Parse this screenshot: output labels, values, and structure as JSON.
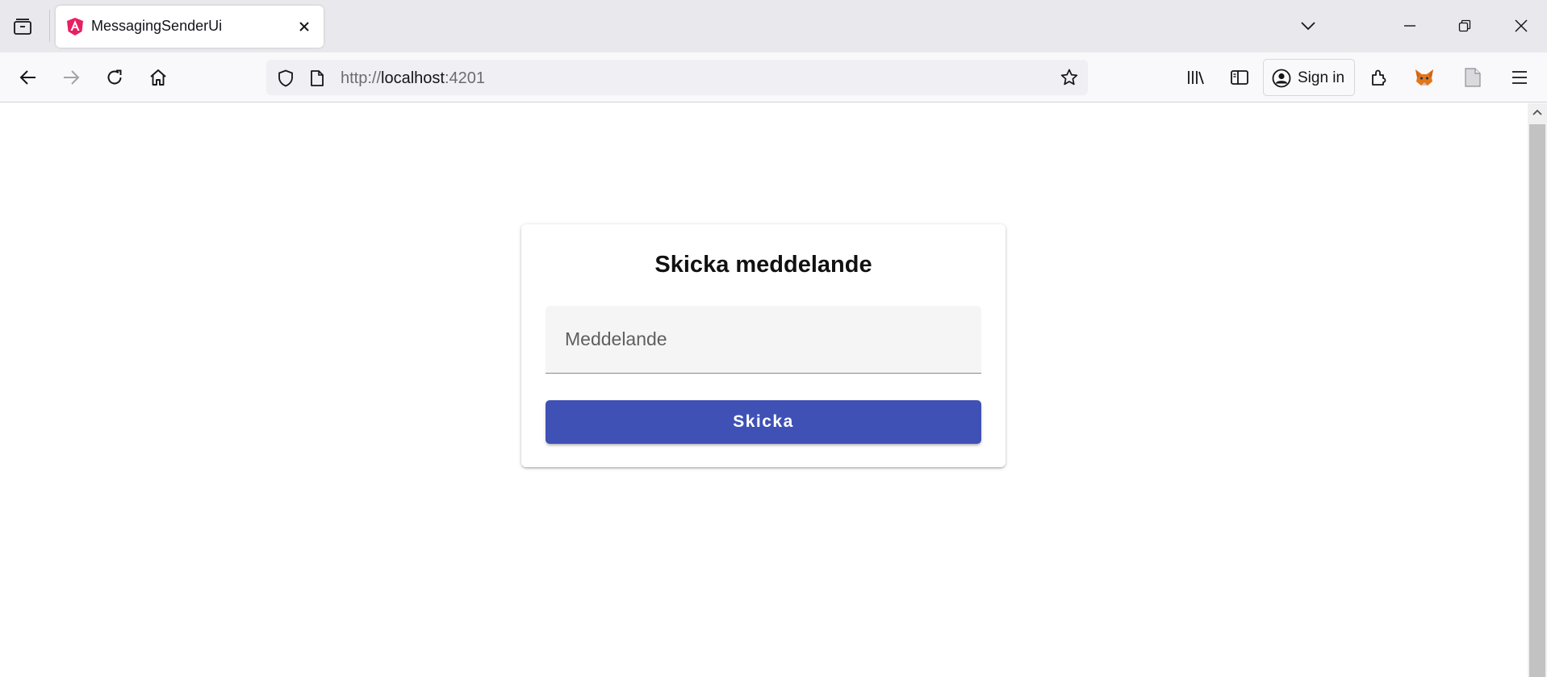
{
  "browser": {
    "tab": {
      "title": "MessagingSenderUi",
      "favicon": "angular-logo-icon"
    },
    "url": {
      "scheme": "http://",
      "host": "localhost",
      "port": ":4201"
    },
    "signin_label": "Sign in",
    "icons": {
      "list_all_tabs": "tab-list-icon",
      "tab_close": "close-icon",
      "tab_overflow": "chevron-down-icon",
      "minimize": "minimize-icon",
      "restore": "restore-icon",
      "close_window": "close-icon",
      "back": "back-arrow-icon",
      "forward": "forward-arrow-icon",
      "reload": "reload-icon",
      "home": "home-icon",
      "tracking_protection": "shield-icon",
      "page_info": "page-icon",
      "bookmark": "star-icon",
      "library": "library-icon",
      "sidebar": "sidebar-icon",
      "account": "account-icon",
      "extensions": "puzzle-icon",
      "metamask": "fox-icon",
      "reader": "document-icon",
      "menu": "hamburger-menu-icon"
    }
  },
  "page": {
    "card": {
      "title": "Skicka meddelande",
      "message_placeholder": "Meddelande",
      "message_value": "",
      "send_label": "Skicka"
    }
  },
  "colors": {
    "primary": "#3f51b5",
    "favicon_pink": "#e91e63"
  }
}
